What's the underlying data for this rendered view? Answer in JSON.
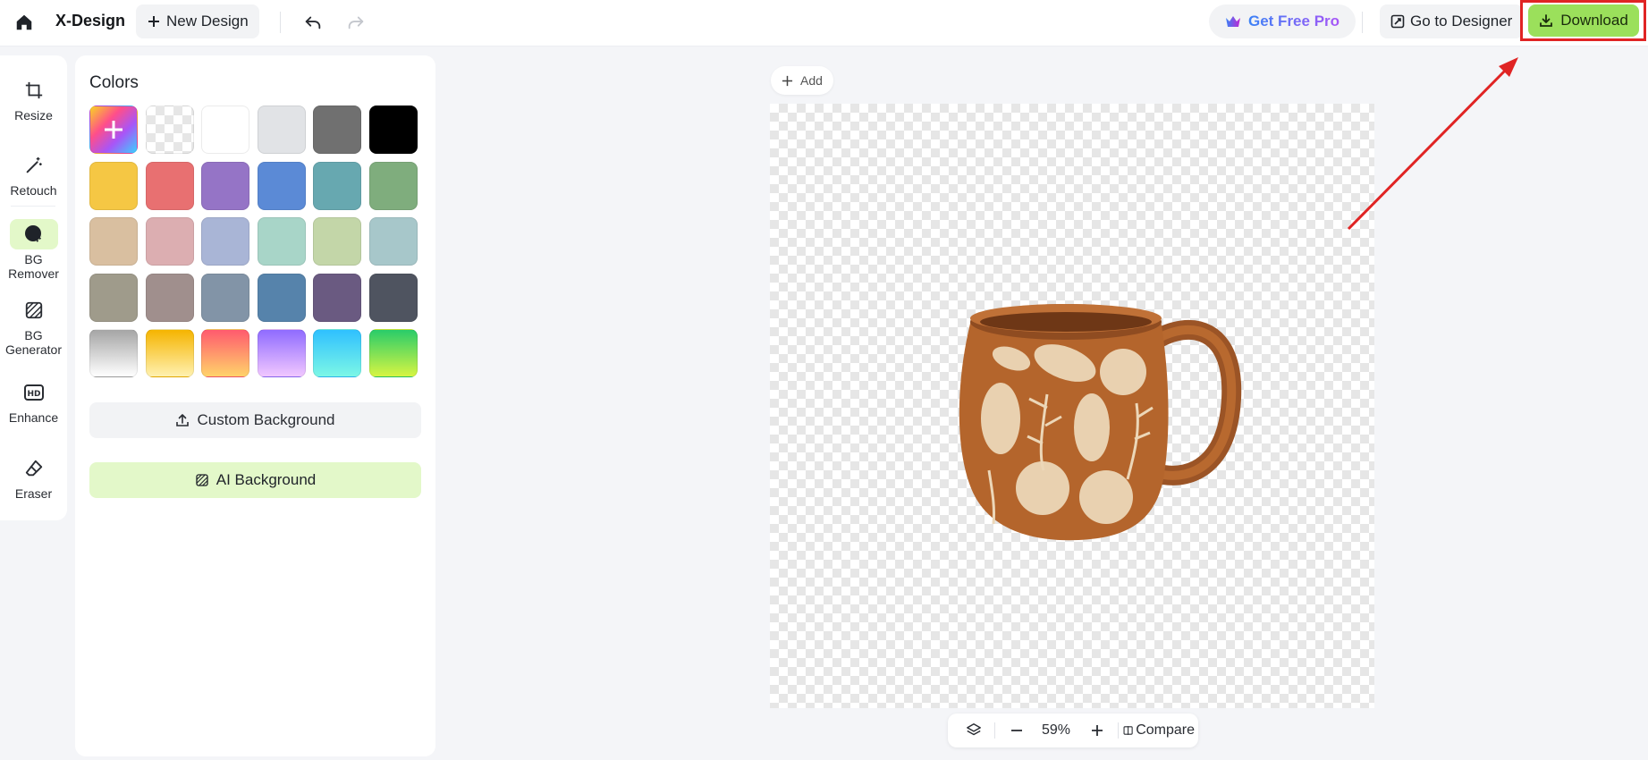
{
  "header": {
    "app_title": "X-Design",
    "new_design_label": "New Design",
    "get_pro_label": "Get Free Pro",
    "go_designer_label": "Go to Designer",
    "download_label": "Download"
  },
  "rail": {
    "tools": [
      {
        "label": "Resize",
        "icon": "crop-icon"
      },
      {
        "label": "Retouch",
        "icon": "magic-wand-icon"
      },
      {
        "label": "BG\nRemover",
        "icon": "bg-remover-icon",
        "active": true
      },
      {
        "label": "BG\nGenerator",
        "icon": "bg-generator-icon"
      },
      {
        "label": "Enhance",
        "icon": "hd-icon"
      },
      {
        "label": "Eraser",
        "icon": "eraser-icon"
      }
    ]
  },
  "colors_panel": {
    "title": "Colors",
    "swatch_rows": [
      [
        "rainbow-add",
        "transparent",
        "#ffffff",
        "#e1e3e6",
        "#707070",
        "#000000"
      ],
      [
        "#f5c744",
        "#e87071",
        "#9574c6",
        "#5b8ad6",
        "#67a8b0",
        "#7fad7d"
      ],
      [
        "#d9bfa0",
        "#dcaeb1",
        "#a9b5d6",
        "#a8d5c8",
        "#c3d6a8",
        "#a7c7ca"
      ],
      [
        "#9f9b8b",
        "#a08f8d",
        "#8294a7",
        "#5683ab",
        "#6a5a81",
        "#4f5460"
      ],
      [
        "grad-gray",
        "grad-yellow",
        "grad-red",
        "grad-purple",
        "grad-cyan",
        "grad-green"
      ]
    ],
    "custom_background_label": "Custom Background",
    "ai_background_label": "AI Background"
  },
  "canvas": {
    "add_label": "Add",
    "image_subject": "ceramic mug with botanical pattern",
    "background": "transparent"
  },
  "bottom_toolbar": {
    "zoom": "59%",
    "compare_label": "Compare"
  },
  "colors": {
    "accent_green": "#9be05b",
    "active_tool_bg": "#e3f8c9",
    "annotation_red": "#e02424"
  }
}
